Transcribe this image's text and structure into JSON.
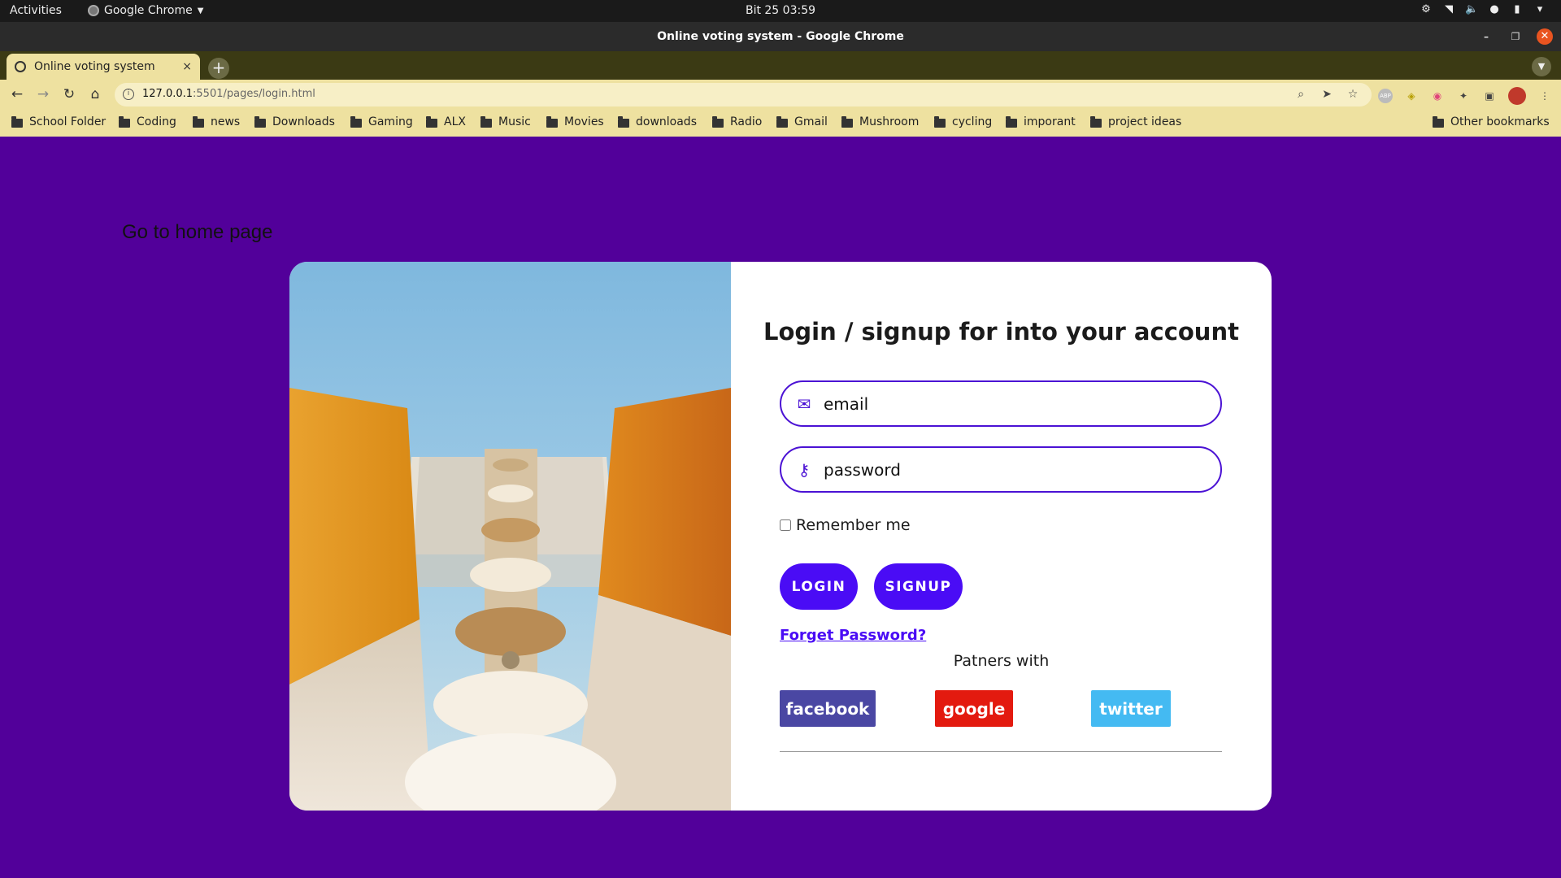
{
  "system": {
    "activities": "Activities",
    "app_name": "Google Chrome",
    "clock": "Bit 25  03:59"
  },
  "window": {
    "title": "Online voting system - Google Chrome"
  },
  "tab": {
    "title": "Online voting system",
    "close": "×"
  },
  "toolbar": {
    "url_host": "127.0.0.1",
    "url_path": ":5501/pages/login.html"
  },
  "bookmarks": [
    "School Folder",
    "Coding",
    "news",
    "Downloads",
    "Gaming",
    "ALX",
    "Music",
    "Movies",
    "downloads",
    "Radio",
    "Gmail",
    "Mushroom",
    "cycling",
    "imporant",
    "project ideas"
  ],
  "other_bookmarks": "Other bookmarks",
  "page": {
    "home_link": "Go to home page",
    "heading": "Login / signup for into your account",
    "email_placeholder": "email",
    "password_placeholder": "password",
    "remember_label": "Remember me",
    "login_label": "LOGIN",
    "signup_label": "SIGNUP",
    "forget_label": "Forget Password?",
    "partners_label": "Patners with",
    "facebook_label": "facebook",
    "google_label": "google",
    "twitter_label": "twitter"
  },
  "colors": {
    "page_bg": "#52009a",
    "accent": "#4a0cf5",
    "facebook": "#4a47a3",
    "google": "#e31a0f",
    "twitter": "#44baf2",
    "chrome_theme": "#eee1a0"
  }
}
